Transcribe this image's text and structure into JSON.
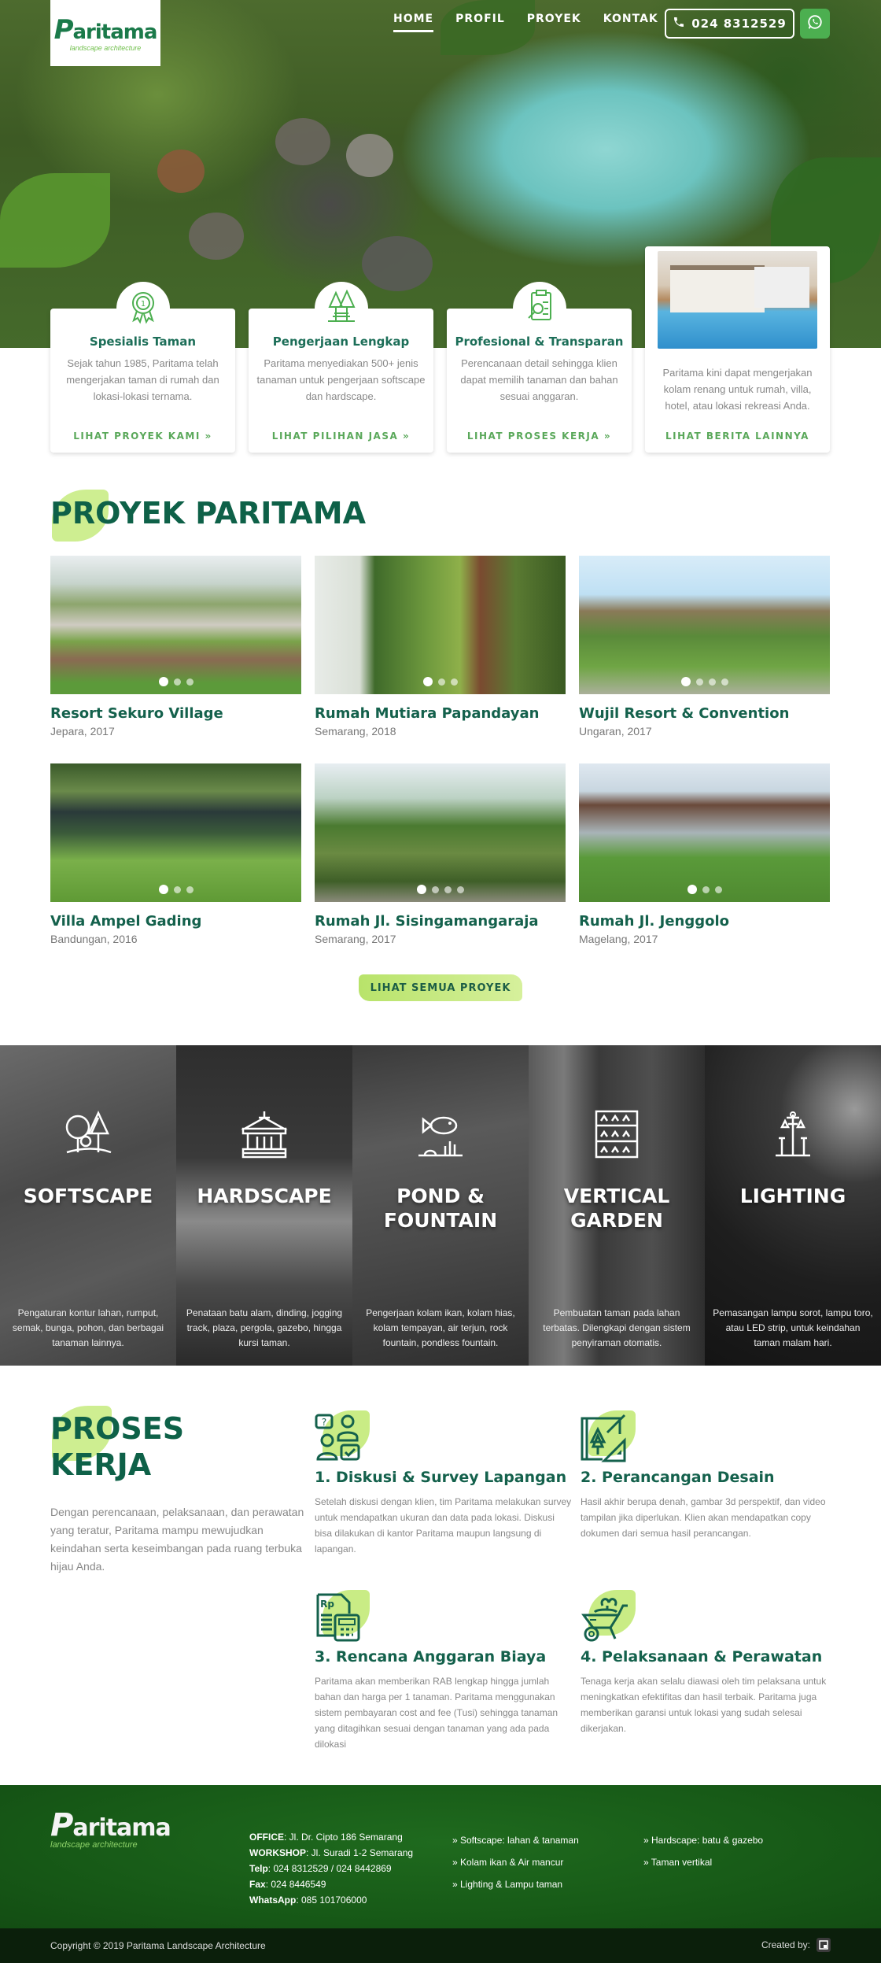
{
  "header": {
    "logo": {
      "word": "aritama",
      "initial": "P",
      "tagline": "landscape architecture"
    },
    "nav": [
      {
        "label": "HOME",
        "active": true
      },
      {
        "label": "PROFIL",
        "active": false
      },
      {
        "label": "PROYEK",
        "active": false
      },
      {
        "label": "KONTAK",
        "active": false
      }
    ],
    "phone": "024 8312529",
    "phone_icon": "phone-icon",
    "whatsapp_icon": "whatsapp-icon"
  },
  "features": [
    {
      "icon": "award-ribbon-icon",
      "title": "Spesialis Taman",
      "text": "Sejak tahun 1985, Paritama telah mengerjakan taman di rumah dan lokasi-lokasi ternama.",
      "link": "LIHAT PROYEK KAMI »"
    },
    {
      "icon": "park-trees-icon",
      "title": "Pengerjaan Lengkap",
      "text": "Paritama menyediakan 500+ jenis tanaman untuk pengerjaan softscape dan hardscape.",
      "link": "LIHAT PILIHAN JASA »"
    },
    {
      "icon": "clipboard-search-icon",
      "title": "Profesional & Transparan",
      "text": "Perencanaan detail sehingga klien dapat memilih tanaman dan bahan sesuai anggaran.",
      "link": "LIHAT PROSES KERJA »"
    },
    {
      "icon": "pool-villa-photo",
      "title": "",
      "text": "Paritama kini dapat mengerjakan kolam renang untuk rumah, villa, hotel, atau lokasi rekreasi Anda.",
      "link": "LIHAT BERITA LAINNYA"
    }
  ],
  "projects": {
    "title": "PROYEK PARITAMA",
    "items": [
      {
        "name": "Resort Sekuro Village",
        "location": "Jepara, 2017",
        "slides": 3,
        "active_slide": 1
      },
      {
        "name": "Rumah Mutiara Papandayan",
        "location": "Semarang, 2018",
        "slides": 3,
        "active_slide": 1
      },
      {
        "name": "Wujil Resort & Convention",
        "location": "Ungaran, 2017",
        "slides": 4,
        "active_slide": 1
      },
      {
        "name": "Villa Ampel Gading",
        "location": "Bandungan, 2016",
        "slides": 3,
        "active_slide": 1
      },
      {
        "name": "Rumah Jl. Sisingamangaraja",
        "location": "Semarang, 2017",
        "slides": 4,
        "active_slide": 1
      },
      {
        "name": "Rumah Jl. Jenggolo",
        "location": "Magelang, 2017",
        "slides": 3,
        "active_slide": 1
      }
    ],
    "button": "LIHAT SEMUA PROYEK"
  },
  "services": [
    {
      "icon": "trees-icon",
      "title_lines": [
        "SOFTSCAPE"
      ],
      "text": "Pengaturan kontur lahan, rumput, semak, bunga, pohon, dan berbagai tanaman lainnya."
    },
    {
      "icon": "gazebo-icon",
      "title_lines": [
        "HARDSCAPE"
      ],
      "text": "Penataan batu alam, dinding, jogging track, plaza, pergola, gazebo, hingga kursi taman."
    },
    {
      "icon": "fish-icon",
      "title_lines": [
        "POND &",
        "FOUNTAIN"
      ],
      "text": "Pengerjaan kolam ikan, kolam hias, kolam tempayan, air terjun, rock fountain, pondless fountain."
    },
    {
      "icon": "vertical-planter-icon",
      "title_lines": [
        "VERTICAL",
        "GARDEN"
      ],
      "text": "Pembuatan taman pada lahan terbatas. Dilengkapi dengan sistem penyiraman otomatis."
    },
    {
      "icon": "street-lamp-icon",
      "title_lines": [
        "LIGHTING"
      ],
      "text": "Pemasangan lampu sorot, lampu toro, atau LED strip, untuk keindahan taman malam hari."
    }
  ],
  "process": {
    "title_lines": [
      "PROSES",
      "KERJA"
    ],
    "intro": "Dengan perencanaan, pelaksanaan, dan perawatan yang teratur, Paritama mampu mewujudkan keindahan serta keseimbangan pada ruang terbuka hijau Anda.",
    "steps": [
      {
        "icon": "discussion-icon",
        "title": "1. Diskusi & Survey Lapangan",
        "text": "Setelah diskusi dengan klien, tim Paritama melakukan survey untuk mendapatkan ukuran dan data pada lokasi. Diskusi bisa dilakukan di kantor Paritama maupun langsung di lapangan."
      },
      {
        "icon": "blueprint-icon",
        "title": "2. Perancangan Desain",
        "text": "Hasil akhir berupa denah, gambar 3d perspektif, dan video tampilan jika diperlukan. Klien akan mendapatkan copy dokumen dari semua hasil perancangan."
      },
      {
        "icon": "budget-calculator-icon",
        "title": "3. Rencana Anggaran Biaya",
        "text": "Paritama akan memberikan RAB lengkap hingga jumlah bahan dan harga per 1 tanaman. Paritama menggunakan sistem pembayaran cost and fee (Tusi) sehingga tanaman yang ditagihkan sesuai dengan tanaman yang ada pada dilokasi"
      },
      {
        "icon": "wheelbarrow-icon",
        "title": "4. Pelaksanaan & Perawatan",
        "text": "Tenaga kerja akan selalu diawasi oleh tim pelaksana untuk meningkatkan efektifitas dan hasil terbaik. Paritama juga memberikan garansi untuk lokasi yang sudah selesai dikerjakan."
      }
    ]
  },
  "footer": {
    "logo": {
      "word": "aritama",
      "initial": "P",
      "tagline": "landscape architecture"
    },
    "contact": [
      {
        "label": "OFFICE",
        "value": "Jl. Dr. Cipto 186 Semarang"
      },
      {
        "label": "WORKSHOP",
        "value": "Jl. Suradi 1-2 Semarang"
      },
      {
        "label": "Telp",
        "value": "024 8312529 / 024 8442869"
      },
      {
        "label": "Fax",
        "value": "024 8446549"
      },
      {
        "label": "WhatsApp",
        "value": "085 101706000"
      }
    ],
    "links_col1": [
      "» Softscape: lahan & tanaman",
      "» Kolam ikan & Air mancur",
      "» Lighting & Lampu taman"
    ],
    "links_col2": [
      "» Hardscape: batu & gazebo",
      "» Taman vertikal"
    ],
    "copyright": "Copyright © 2019 Paritama Landscape Architecture",
    "created_by": "Created by:"
  },
  "colors": {
    "brand_dark_green": "#0e6148",
    "accent_lime": "#c9ec85",
    "link_green": "#5aa85a",
    "whatsapp_green": "#4caf50",
    "footer_green": "#175a17"
  }
}
